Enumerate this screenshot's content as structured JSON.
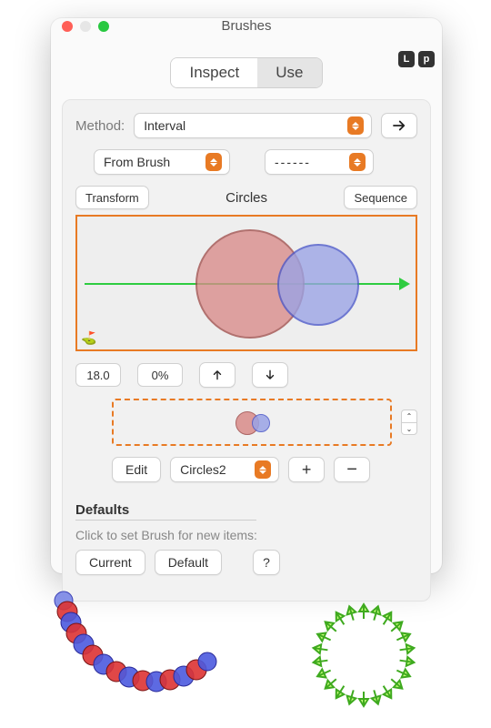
{
  "window": {
    "title": "Brushes",
    "corner": {
      "l": "L",
      "p": "p"
    }
  },
  "tabs": {
    "inspect": "Inspect",
    "use": "Use",
    "selected": "use"
  },
  "method": {
    "label": "Method:",
    "value": "Interval"
  },
  "source": {
    "value": "From Brush",
    "pattern": "------"
  },
  "segments": {
    "transform": "Transform",
    "circles_label": "Circles",
    "sequence": "Sequence"
  },
  "values": {
    "spacing": "18.0",
    "offset": "0%"
  },
  "brush_list": {
    "edit": "Edit",
    "selected": "Circles2",
    "add": "+",
    "remove": "−"
  },
  "defaults": {
    "heading": "Defaults",
    "hint": "Click to set Brush for new items:",
    "current": "Current",
    "default": "Default",
    "help": "?"
  },
  "icons": {
    "arrow_right": "arrow-right-icon",
    "arrow_up": "arrow-up-icon",
    "arrow_down": "arrow-down-icon"
  }
}
